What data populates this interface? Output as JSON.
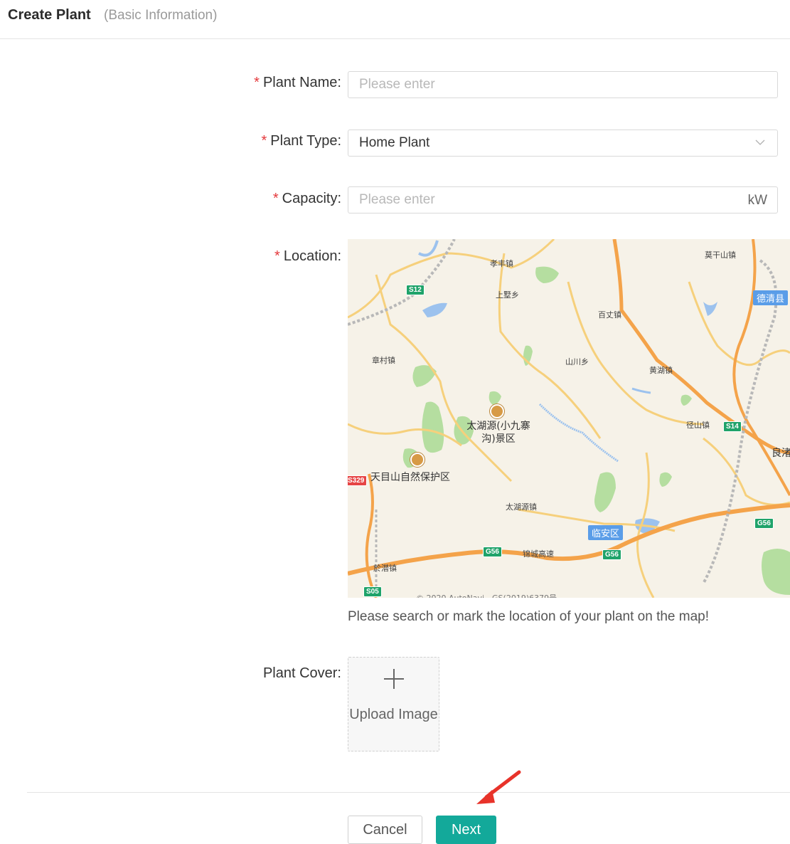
{
  "header": {
    "title": "Create Plant",
    "subtitle": "(Basic Information)"
  },
  "form": {
    "plant_name": {
      "label": "Plant Name:",
      "placeholder": "Please enter",
      "required": true
    },
    "plant_type": {
      "label": "Plant Type:",
      "value": "Home Plant",
      "required": true
    },
    "capacity": {
      "label": "Capacity:",
      "placeholder": "Please enter",
      "unit": "kW",
      "required": true
    },
    "location": {
      "label": "Location:",
      "required": true,
      "hint": "Please search or mark the location of your plant on the map!",
      "map_labels": {
        "xiaofeng": "孝丰镇",
        "shanggan": "上墅乡",
        "baizhang": "百丈镇",
        "moganshan": "莫干山镇",
        "deqing": "德清县",
        "zhangcun": "章村镇",
        "shanchuan": "山川乡",
        "huanghu": "黄湖镇",
        "taihuyuan_scenic": "太湖源(小九寨沟)景区",
        "pingshan": "径山镇",
        "liangzhu": "良渚",
        "tianmushan": "天目山自然保护区",
        "taihuyuan_town": "太湖源镇",
        "linan": "临安区",
        "yuqian": "於潜镇",
        "jinhu": "锦城高速"
      },
      "map_shields": {
        "s12": "S12",
        "s14": "S14",
        "g56a": "G56",
        "g56b": "G56",
        "g56c": "G56",
        "s05": "S05",
        "s329": "S329"
      },
      "map_copyright": "© 2020 AutoNavi - GS(2019)6379号"
    },
    "plant_cover": {
      "label": "Plant Cover:",
      "upload_text": "Upload Image"
    }
  },
  "footer": {
    "cancel_label": "Cancel",
    "next_label": "Next"
  },
  "colors": {
    "primary": "#13a99a",
    "required": "#e4393c",
    "annotation_arrow": "#e8332a"
  }
}
